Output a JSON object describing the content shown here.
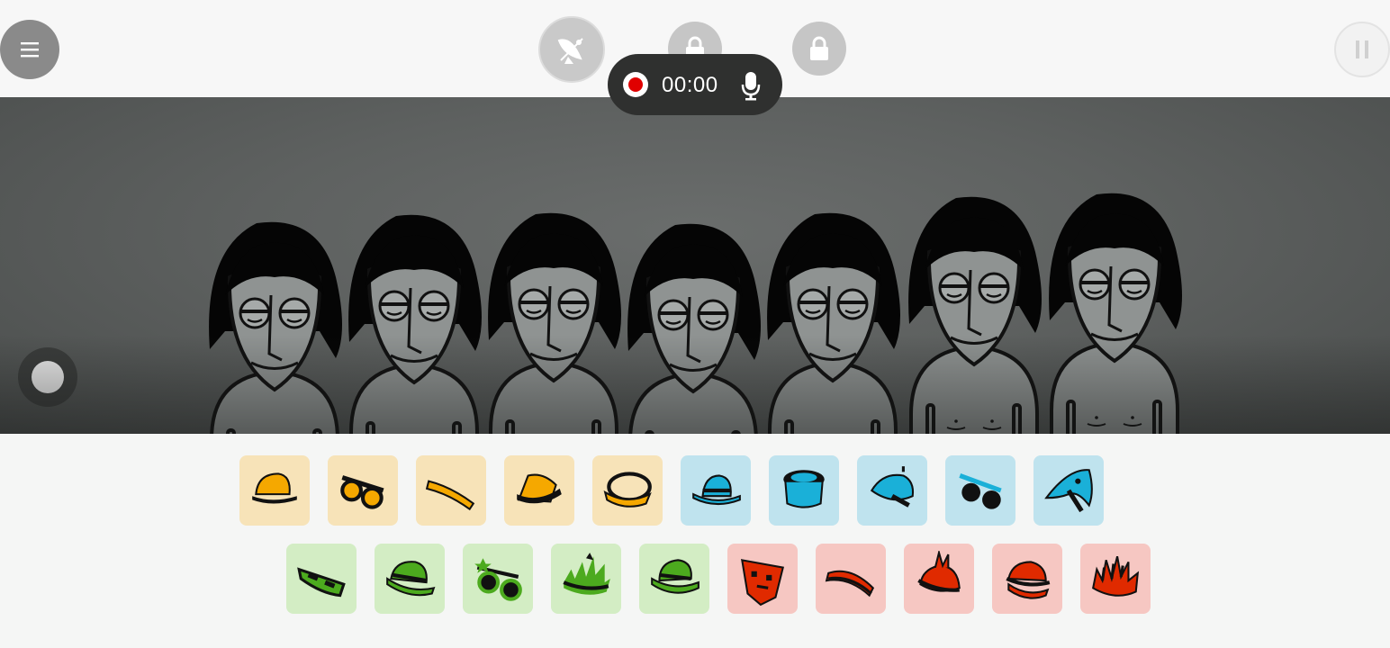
{
  "recorder": {
    "time": "00:00"
  },
  "colors": {
    "yellow": "#f5a800",
    "blue": "#1ab0d8",
    "green": "#4caa1e",
    "red": "#e02a00",
    "stage_bg": "#5e6160"
  },
  "characters": {
    "count": 7,
    "state": "idle-gray"
  },
  "sound_icons": {
    "row1": [
      {
        "group": "yellow",
        "icon": "cap-icon"
      },
      {
        "group": "yellow",
        "icon": "sunglasses-icon"
      },
      {
        "group": "yellow",
        "icon": "headband-icon"
      },
      {
        "group": "yellow",
        "icon": "bowler-hat-icon"
      },
      {
        "group": "yellow",
        "icon": "visor-icon"
      },
      {
        "group": "blue",
        "icon": "fedora-icon"
      },
      {
        "group": "blue",
        "icon": "drum-hat-icon"
      },
      {
        "group": "blue",
        "icon": "beret-icon"
      },
      {
        "group": "blue",
        "icon": "glasses-icon"
      },
      {
        "group": "blue",
        "icon": "bandana-icon"
      }
    ],
    "row2": [
      {
        "group": "green",
        "icon": "mask-icon"
      },
      {
        "group": "green",
        "icon": "green-hat-icon"
      },
      {
        "group": "green",
        "icon": "star-glasses-icon"
      },
      {
        "group": "green",
        "icon": "grass-hair-icon"
      },
      {
        "group": "green",
        "icon": "trilby-icon"
      },
      {
        "group": "red",
        "icon": "face-mask-icon"
      },
      {
        "group": "red",
        "icon": "red-band-icon"
      },
      {
        "group": "red",
        "icon": "mohawk-icon"
      },
      {
        "group": "red",
        "icon": "red-cap-icon"
      },
      {
        "group": "red",
        "icon": "spiky-hair-icon"
      }
    ]
  }
}
